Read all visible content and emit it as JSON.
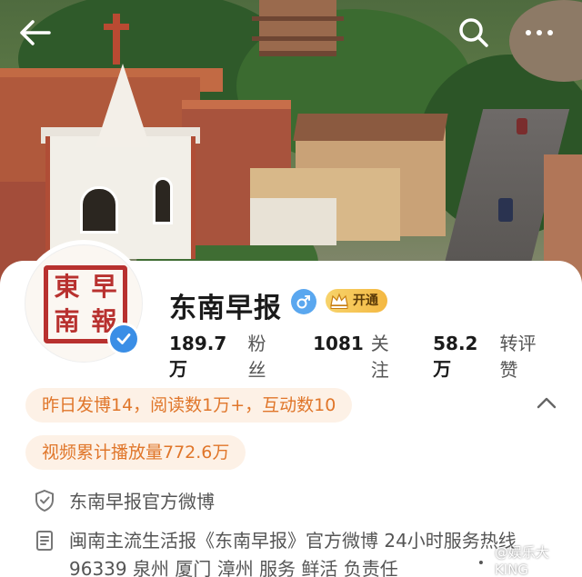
{
  "profile": {
    "name": "东南早报",
    "vip_label": "开通",
    "avatar_seal_chars": [
      "東",
      "早",
      "南",
      "報"
    ]
  },
  "stats": [
    {
      "value": "189.7万",
      "label": "粉丝"
    },
    {
      "value": "1081",
      "label": "关注"
    },
    {
      "value": "58.2万",
      "label": "转评赞"
    }
  ],
  "highlights": {
    "activity": "昨日发博14，阅读数1万+，互动数10",
    "video_plays": "视频累计播放量772.6万"
  },
  "info": {
    "verified_as": "东南早报官方微博",
    "bio": "闽南主流生活报《东南早报》官方微博 24小时服务热线96339 泉州 厦门 漳州 服务 鲜活 负责任"
  },
  "watermark": "@娱乐大KING",
  "colors": {
    "accent_orange": "#e0762a",
    "pill_bg": "#fdf1e6",
    "verify_blue": "#3a8ee6",
    "gender_blue": "#5aa7ef",
    "vip_gold": "#f4b842",
    "seal_red": "#b8312f"
  },
  "icons": {
    "back": "back-arrow-icon",
    "search": "search-icon",
    "more": "more-dots-icon",
    "collapse": "chevron-up-icon",
    "verified": "verified-check-icon",
    "gender": "male-icon",
    "vip": "crown-icon",
    "shield": "shield-icon",
    "bio": "document-icon"
  }
}
